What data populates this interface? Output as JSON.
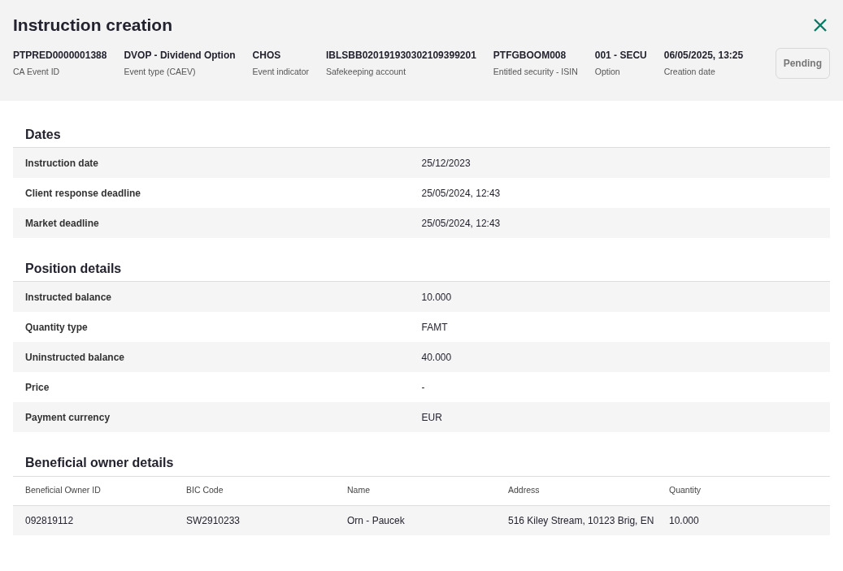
{
  "window": {
    "title": "Instruction creation"
  },
  "summary": [
    {
      "value": "PTPRED0000001388",
      "label": "CA Event ID"
    },
    {
      "value": "DVOP - Dividend Option",
      "label": "Event type (CAEV)"
    },
    {
      "value": "CHOS",
      "label": "Event indicator"
    },
    {
      "value": "IBLSBB020191930302109399201",
      "label": "Safekeeping account"
    },
    {
      "value": "PTFGBOOM008",
      "label": "Entitled security - ISIN"
    },
    {
      "value": "001 - SECU",
      "label": "Option"
    },
    {
      "value": "06/05/2025, 13:25",
      "label": "Creation date"
    }
  ],
  "status": {
    "label": "Pending"
  },
  "sections": [
    {
      "title": "Dates",
      "rows": [
        {
          "label": "Instruction date",
          "value": "25/12/2023"
        },
        {
          "label": "Client response deadline",
          "value": "25/05/2024, 12:43"
        },
        {
          "label": "Market deadline",
          "value": "25/05/2024, 12:43"
        }
      ]
    },
    {
      "title": "Position details",
      "rows": [
        {
          "label": "Instructed balance",
          "value": "10.000"
        },
        {
          "label": "Quantity type",
          "value": "FAMT"
        },
        {
          "label": "Uninstructed balance",
          "value": "40.000"
        },
        {
          "label": "Price",
          "value": "-"
        },
        {
          "label": "Payment currency",
          "value": "EUR"
        }
      ]
    }
  ],
  "beneficial_owners": {
    "title": "Beneficial owner details",
    "columns": [
      "Beneficial Owner ID",
      "BIC Code",
      "Name",
      "Address",
      "Quantity"
    ],
    "rows": [
      [
        "092819112",
        "SW2910233",
        "Orn - Paucek",
        "516 Kiley Stream, 10123 Brig, EN",
        "10.000"
      ]
    ]
  }
}
